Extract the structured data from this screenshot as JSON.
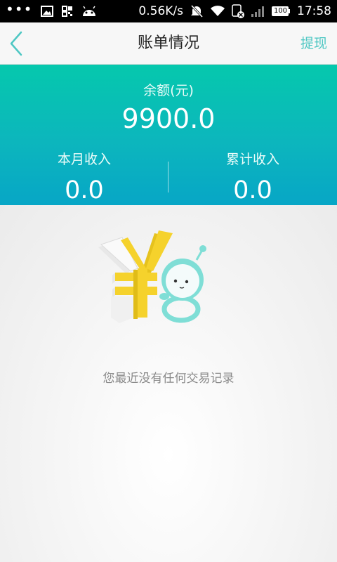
{
  "status_bar": {
    "network_speed": "0.56K/s",
    "battery_level": "100",
    "time": "17:58",
    "icons": [
      "more-dots-icon",
      "image-icon",
      "qr-icon",
      "android-icon",
      "mute-icon",
      "wifi-icon",
      "sim-icon",
      "signal-icon",
      "battery-icon"
    ]
  },
  "nav": {
    "title": "账单情况",
    "action": "提现",
    "back_icon": "chevron-left-icon"
  },
  "balance": {
    "label": "余额(元)",
    "value": "9900.0"
  },
  "stats": {
    "monthly_label": "本月收入",
    "monthly_value": "0.0",
    "total_label": "累计收入",
    "total_value": "0.0"
  },
  "empty": {
    "message": "您最近没有任何交易记录",
    "illustration": "yuan-mascot-illustration"
  },
  "colors": {
    "accent": "#4ec7c3",
    "header_gradient_top": "#05c8ad",
    "header_gradient_bottom": "#07a6c6",
    "yuan_yellow": "#f5d22c",
    "mascot_cyan": "#7fded6"
  }
}
